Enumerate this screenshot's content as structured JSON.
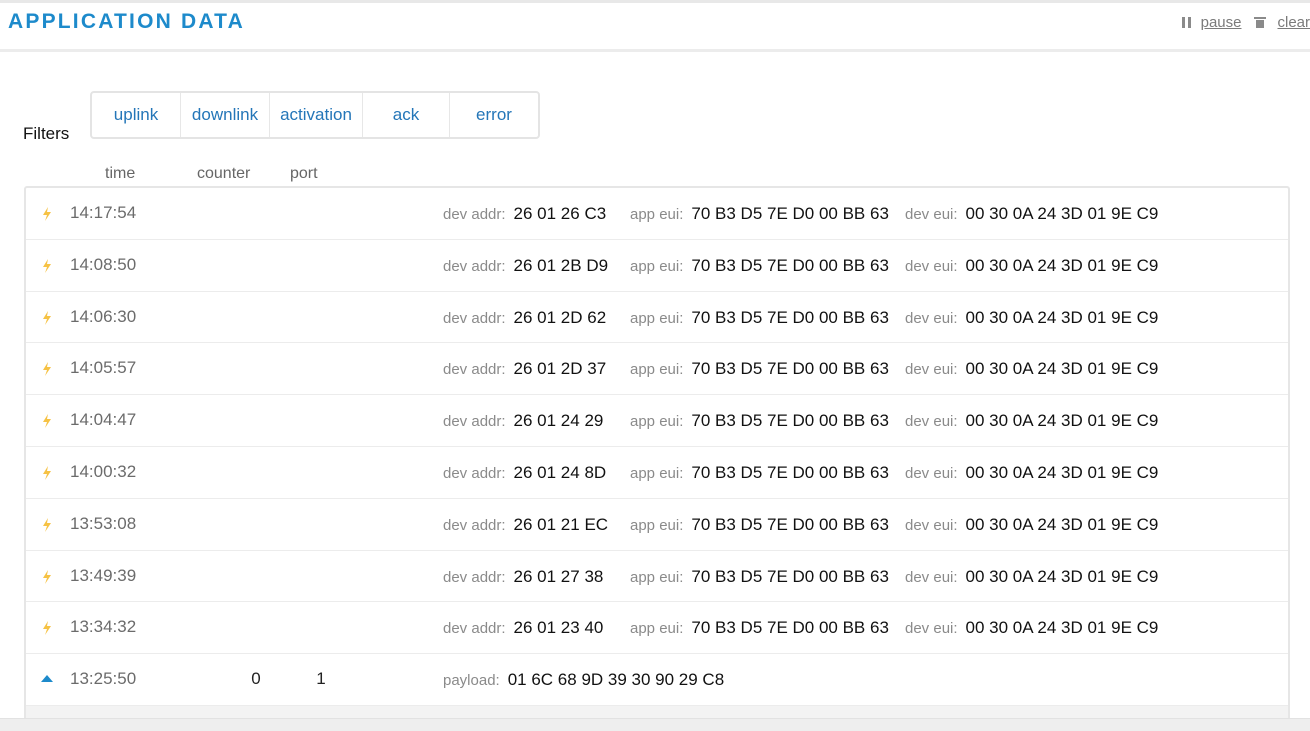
{
  "header": {
    "title": "APPLICATION DATA",
    "pause_label": "pause",
    "clear_label": "clear"
  },
  "filters": {
    "label": "Filters",
    "buttons": [
      "uplink",
      "downlink",
      "activation",
      "ack",
      "error"
    ]
  },
  "columns": {
    "time": "time",
    "counter": "counter",
    "port": "port"
  },
  "labels": {
    "dev_addr": "dev addr:",
    "app_eui": "app eui:",
    "dev_eui": "dev eui:",
    "payload": "payload:"
  },
  "colors": {
    "accent": "#1d8acb",
    "activation_icon": "#f6c244"
  },
  "rows": [
    {
      "type": "activation",
      "icon": "lightning-icon",
      "time": "14:17:54",
      "dev_addr": "26 01 26 C3",
      "app_eui": "70 B3 D5 7E D0 00 BB 63",
      "dev_eui": "00 30 0A 24 3D 01 9E C9"
    },
    {
      "type": "activation",
      "icon": "lightning-icon",
      "time": "14:08:50",
      "dev_addr": "26 01 2B D9",
      "app_eui": "70 B3 D5 7E D0 00 BB 63",
      "dev_eui": "00 30 0A 24 3D 01 9E C9"
    },
    {
      "type": "activation",
      "icon": "lightning-icon",
      "time": "14:06:30",
      "dev_addr": "26 01 2D 62",
      "app_eui": "70 B3 D5 7E D0 00 BB 63",
      "dev_eui": "00 30 0A 24 3D 01 9E C9"
    },
    {
      "type": "activation",
      "icon": "lightning-icon",
      "time": "14:05:57",
      "dev_addr": "26 01 2D 37",
      "app_eui": "70 B3 D5 7E D0 00 BB 63",
      "dev_eui": "00 30 0A 24 3D 01 9E C9"
    },
    {
      "type": "activation",
      "icon": "lightning-icon",
      "time": "14:04:47",
      "dev_addr": "26 01 24 29",
      "app_eui": "70 B3 D5 7E D0 00 BB 63",
      "dev_eui": "00 30 0A 24 3D 01 9E C9"
    },
    {
      "type": "activation",
      "icon": "lightning-icon",
      "time": "14:00:32",
      "dev_addr": "26 01 24 8D",
      "app_eui": "70 B3 D5 7E D0 00 BB 63",
      "dev_eui": "00 30 0A 24 3D 01 9E C9"
    },
    {
      "type": "activation",
      "icon": "lightning-icon",
      "time": "13:53:08",
      "dev_addr": "26 01 21 EC",
      "app_eui": "70 B3 D5 7E D0 00 BB 63",
      "dev_eui": "00 30 0A 24 3D 01 9E C9"
    },
    {
      "type": "activation",
      "icon": "lightning-icon",
      "time": "13:49:39",
      "dev_addr": "26 01 27 38",
      "app_eui": "70 B3 D5 7E D0 00 BB 63",
      "dev_eui": "00 30 0A 24 3D 01 9E C9"
    },
    {
      "type": "activation",
      "icon": "lightning-icon",
      "time": "13:34:32",
      "dev_addr": "26 01 23 40",
      "app_eui": "70 B3 D5 7E D0 00 BB 63",
      "dev_eui": "00 30 0A 24 3D 01 9E C9"
    },
    {
      "type": "uplink",
      "icon": "arrow-up-icon",
      "time": "13:25:50",
      "counter": "0",
      "port": "1",
      "payload": "01 6C 68 9D 39 30 90 29 C8"
    }
  ]
}
